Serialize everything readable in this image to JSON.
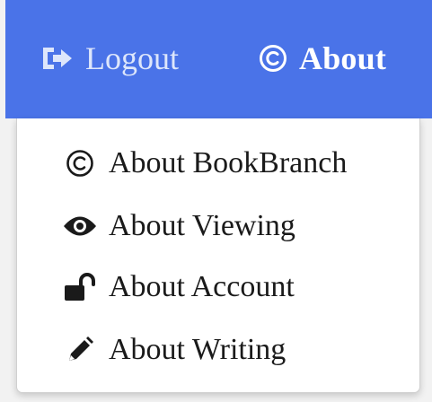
{
  "navbar": {
    "background": "#4a73e8",
    "logout": {
      "label": "Logout",
      "icon": "sign-out-icon"
    },
    "about": {
      "label": "About",
      "icon": "copyright-icon"
    }
  },
  "dropdown": {
    "items": [
      {
        "label": "About BookBranch",
        "icon": "copyright-icon"
      },
      {
        "label": "About Viewing",
        "icon": "eye-icon"
      },
      {
        "label": "About Account",
        "icon": "unlock-icon"
      },
      {
        "label": "About Writing",
        "icon": "pencil-icon"
      }
    ]
  }
}
